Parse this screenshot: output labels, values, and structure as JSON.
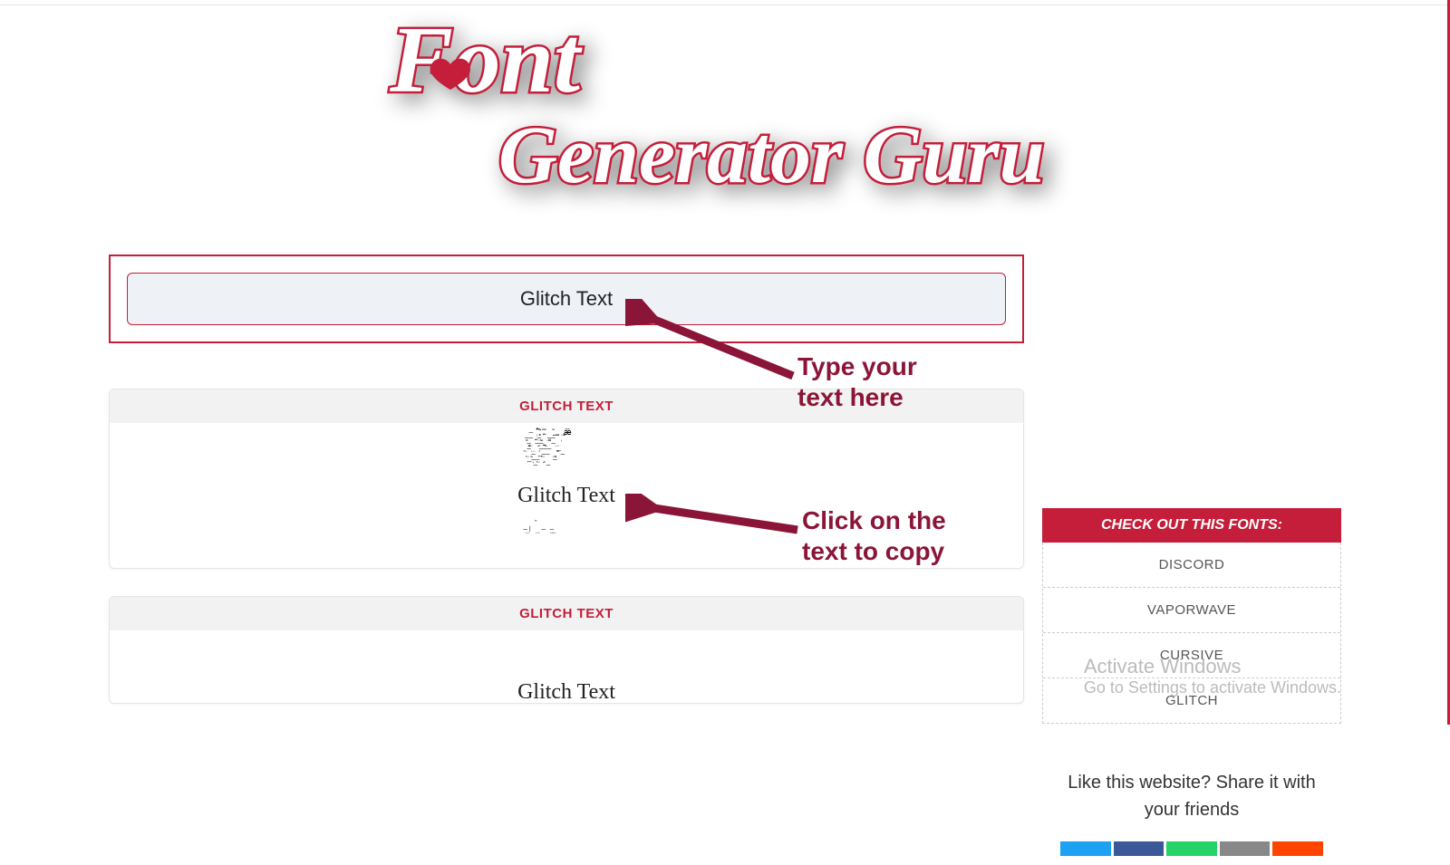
{
  "logo": {
    "line1": "Font",
    "line2": "Generator Guru"
  },
  "input": {
    "value": "Glitch Text"
  },
  "cards": [
    {
      "header": "GLITCH TEXT",
      "text": "Glitch Text"
    },
    {
      "header": "GLITCH TEXT",
      "text": "Glitch Text"
    }
  ],
  "annotations": {
    "type_here": "Type your\ntext here",
    "click_copy": "Click on the\ntext to copy"
  },
  "sidebar": {
    "header": "CHECK OUT THIS FONTS:",
    "items": [
      "DISCORD",
      "VAPORWAVE",
      "CURSIVE",
      "GLITCH"
    ]
  },
  "share": {
    "title": "Like this website? Share it with your friends"
  },
  "watermark": {
    "line1": "Activate Windows",
    "line2": "Go to Settings to activate Windows."
  }
}
